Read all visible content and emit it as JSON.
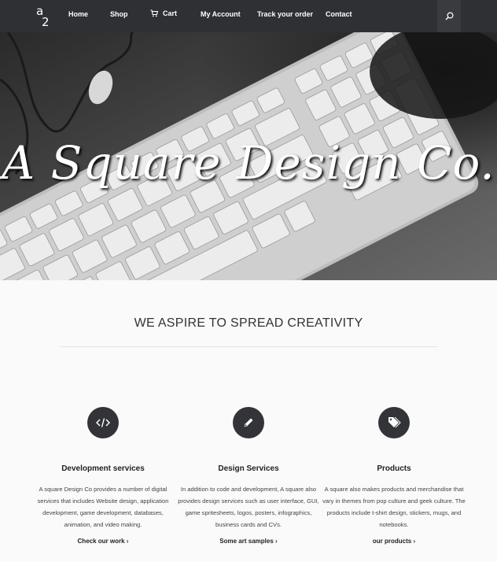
{
  "nav": {
    "logo_icon": "a2-logo-icon",
    "items": [
      {
        "label": "Home"
      },
      {
        "label": "Shop"
      },
      {
        "label": "Cart",
        "icon": "cart-icon"
      },
      {
        "label": "My Account"
      },
      {
        "label": "Track your order"
      },
      {
        "label": "Contact"
      }
    ],
    "search_icon": "search-icon",
    "background": "#2f3033"
  },
  "hero": {
    "title": "A Square Design Co."
  },
  "tagline": "WE ASPIRE TO SPREAD CREATIVITY",
  "services": [
    {
      "icon": "code-icon",
      "title": "Development services",
      "description": "A square Design Co provides a number of digital services that includes Website design, application development, game development, databases, animation, and video making.",
      "link": "Check our work"
    },
    {
      "icon": "pencil-icon",
      "title": "Design Services",
      "description": "In addition to code and development, A square also provides design services such as user interface, GUI, game spritesheets, logos, posters, infographics, business cards and CVs.",
      "link": "Some art samples"
    },
    {
      "icon": "tags-icon",
      "title": "Products",
      "description": "A square also makes products and merchandise that vary in themes from pop culture and geek culture. The products include t-shirt design, stickers, mugs, and notebooks.",
      "link": "our products"
    }
  ]
}
